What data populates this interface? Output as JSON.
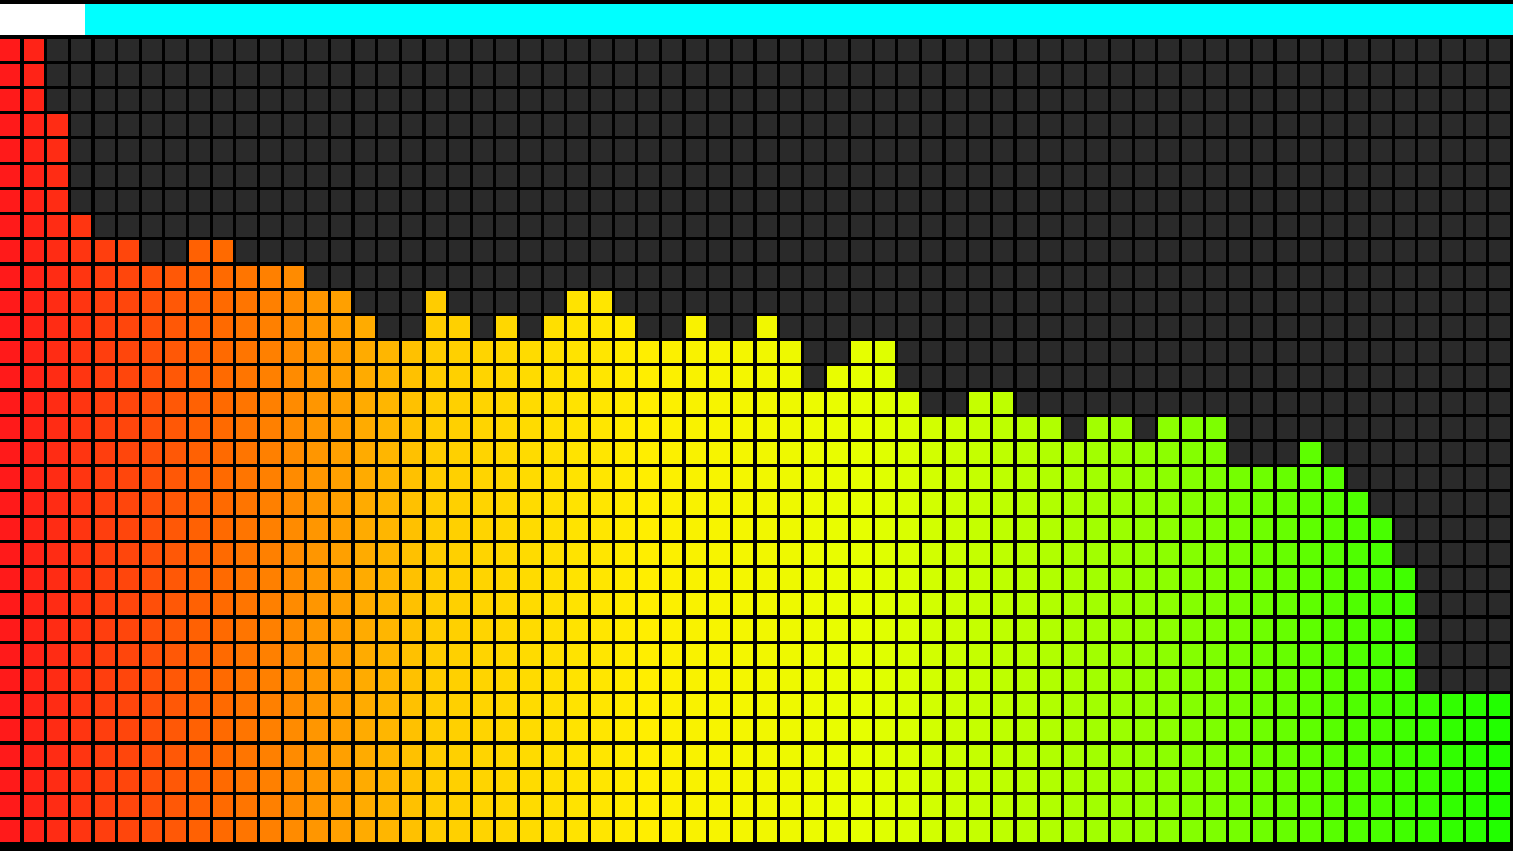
{
  "app": {
    "name": "spectrum-visualizer"
  },
  "progress": {
    "value_fraction": 0.056,
    "label": ""
  },
  "colors": {
    "background": "#000000",
    "unlit_cell": "#2a2a2a",
    "progress_track": "#00ffff",
    "progress_fill": "#ffffff",
    "palette": [
      "#ff1a1a",
      "#ff6a00",
      "#ffcc00",
      "#ffee00",
      "#e6ff00",
      "#aaff00",
      "#66ff00",
      "#22ff00"
    ]
  },
  "spectrum": {
    "rows": 32,
    "bars": [
      32,
      32,
      29,
      25,
      24,
      24,
      23,
      23,
      24,
      24,
      23,
      23,
      23,
      22,
      22,
      21,
      20,
      20,
      22,
      21,
      20,
      21,
      20,
      21,
      22,
      22,
      21,
      20,
      20,
      21,
      20,
      20,
      21,
      20,
      18,
      19,
      20,
      20,
      18,
      17,
      17,
      18,
      18,
      17,
      17,
      16,
      17,
      17,
      16,
      17,
      17,
      17,
      15,
      15,
      15,
      16,
      15,
      14,
      13,
      11,
      6,
      6,
      6,
      6
    ]
  }
}
